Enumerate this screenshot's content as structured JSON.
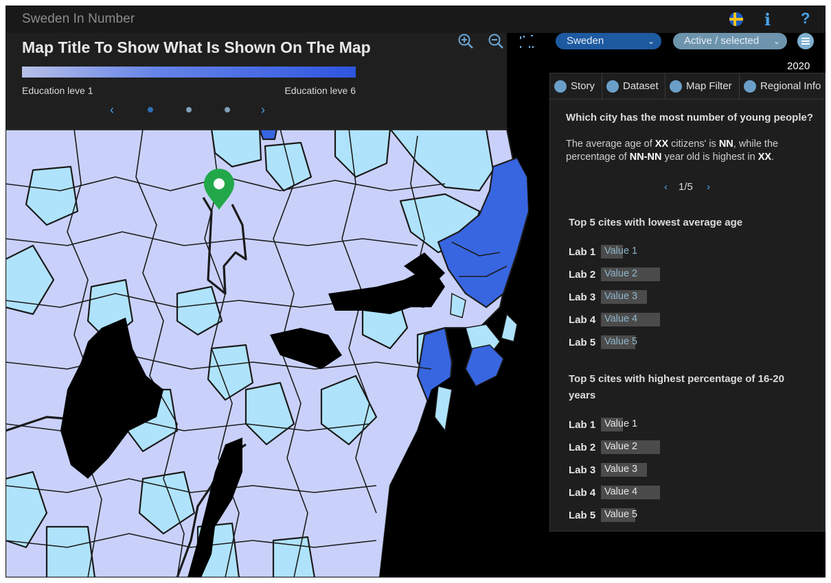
{
  "app": {
    "title": "Sweden In Number"
  },
  "header": {
    "info_glyph": "i",
    "help_glyph": "?"
  },
  "legend": {
    "title": "Map Title To Show What Is Shown On The Map",
    "min_label": "Education leve 1",
    "max_label": "Education leve 6",
    "prev": "‹",
    "next": "›",
    "dots": 3,
    "active_dot": 0
  },
  "controls": {
    "country": "Sweden",
    "mode": "Active / selected",
    "year": "2020",
    "chevron": "⌄"
  },
  "colors": {
    "region_light": "#c9d1fb",
    "region_cyan": "#afe3fb",
    "region_selected": "#3866e0",
    "water": "#000000",
    "marker": "#22a84a",
    "accent": "#4aa3e8"
  },
  "tabs": [
    {
      "label": "Story",
      "icon": "lightbulb-icon"
    },
    {
      "label": "Dataset",
      "icon": "dots-icon"
    },
    {
      "label": "Map Filter",
      "icon": "filter-icon"
    },
    {
      "label": "Regional Info",
      "icon": "bookmark-icon"
    }
  ],
  "story": {
    "question": "Which city has the most number of young people?",
    "text_1": "The average age of ",
    "b_1": "XX",
    "text_2": " citizens' is ",
    "b_2": "NN",
    "text_3": ", while the percentage of ",
    "b_3": "NN-NN",
    "text_4": " year old is highest in ",
    "b_4": "XX",
    "text_5": ".",
    "pager": {
      "prev": "‹",
      "label": "1/5",
      "next": "›"
    }
  },
  "section1": {
    "title": "Top 5 cites with lowest average age",
    "rows": [
      {
        "label": "Lab 1",
        "value": "Value 1",
        "level": 0.18
      },
      {
        "label": "Lab 2",
        "value": "Value 2",
        "level": 0.48
      },
      {
        "label": "Lab 3",
        "value": "Value 3",
        "level": 0.37
      },
      {
        "label": "Lab 4",
        "value": "Value 4",
        "level": 0.48
      },
      {
        "label": "Lab 5",
        "value": "Value 5",
        "level": 0.28
      }
    ]
  },
  "section2": {
    "title": "Top 5 cites with highest percentage of 16-20 years",
    "rows": [
      {
        "label": "Lab 1",
        "value": "Value 1",
        "level": 0.18
      },
      {
        "label": "Lab 2",
        "value": "Value 2",
        "level": 0.48
      },
      {
        "label": "Lab 3",
        "value": "Value 3",
        "level": 0.37
      },
      {
        "label": "Lab 4",
        "value": "Value 4",
        "level": 0.48
      },
      {
        "label": "Lab 5",
        "value": "Value 5",
        "level": 0.28
      }
    ]
  }
}
